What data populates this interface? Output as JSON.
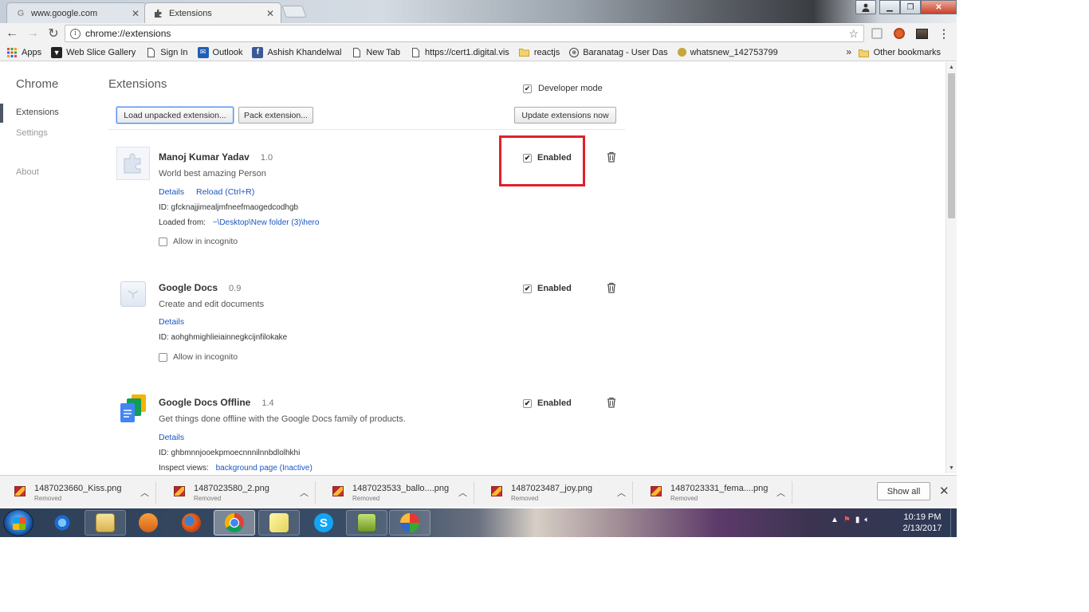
{
  "tabs": [
    {
      "title": "www.google.com",
      "favicon": "google-icon"
    },
    {
      "title": "Extensions",
      "favicon": "puzzle-icon"
    }
  ],
  "toolbar": {
    "url": "chrome://extensions"
  },
  "bookmarks": {
    "items": [
      {
        "label": "Apps",
        "icon": "apps-grid-icon"
      },
      {
        "label": "Web Slice Gallery",
        "icon": "web-slice-icon"
      },
      {
        "label": "Sign In",
        "icon": "page-icon"
      },
      {
        "label": "Outlook",
        "icon": "outlook-icon"
      },
      {
        "label": "Ashish Khandelwal",
        "icon": "facebook-icon"
      },
      {
        "label": "New Tab",
        "icon": "page-icon"
      },
      {
        "label": "https://cert1.digital.vis",
        "icon": "page-icon"
      },
      {
        "label": "reactjs",
        "icon": "folder-icon"
      },
      {
        "label": "Baranatag - User Das",
        "icon": "globe-icon"
      },
      {
        "label": "whatsnew_142753799",
        "icon": "emoji-icon"
      }
    ],
    "more": "»",
    "other": "Other bookmarks"
  },
  "sidebar": {
    "title": "Chrome",
    "items": [
      {
        "label": "Extensions"
      },
      {
        "label": "Settings"
      },
      {
        "label": "About"
      }
    ]
  },
  "main": {
    "title": "Extensions",
    "developer_mode": {
      "label": "Developer mode",
      "checked": true
    },
    "buttons": {
      "load_unpacked": "Load unpacked extension...",
      "pack": "Pack extension...",
      "update": "Update extensions now"
    },
    "extensions": [
      {
        "name": "Manoj Kumar Yadav",
        "version": "1.0",
        "description": "World best amazing Person",
        "links": [
          "Details",
          "Reload (Ctrl+R)"
        ],
        "id_line": "ID: gfcknajjimealjmfneefmaogedcodhgb",
        "loaded_label": "Loaded from:",
        "loaded_path": "~\\Desktop\\New folder (3)\\hero",
        "incognito": "Allow in incognito",
        "enabled": "Enabled"
      },
      {
        "name": "Google Docs",
        "version": "0.9",
        "description": "Create and edit documents",
        "links": [
          "Details"
        ],
        "id_line": "ID: aohghmighlieiainnegkcijnfilokake",
        "incognito": "Allow in incognito",
        "enabled": "Enabled"
      },
      {
        "name": "Google Docs Offline",
        "version": "1.4",
        "description": "Get things done offline with the Google Docs family of products.",
        "links": [
          "Details"
        ],
        "id_line": "ID: ghbmnnjooekpmoecnnnilnnbdlolhkhi",
        "inspect_label": "Inspect views:",
        "inspect_link": "background page (Inactive)",
        "enabled": "Enabled"
      }
    ]
  },
  "downloads": {
    "items": [
      {
        "name": "1487023660_Kiss.png",
        "status": "Removed"
      },
      {
        "name": "1487023580_2.png",
        "status": "Removed"
      },
      {
        "name": "1487023533_ballo....png",
        "status": "Removed"
      },
      {
        "name": "1487023487_joy.png",
        "status": "Removed"
      },
      {
        "name": "1487023331_fema....png",
        "status": "Removed"
      }
    ],
    "show_all": "Show all"
  },
  "taskbar": {
    "apps": [
      "ie-icon",
      "explorer-icon",
      "media-player-icon",
      "firefox-icon",
      "chrome-icon",
      "sticky-notes-icon",
      "skype-icon",
      "notepad-icon",
      "paint-icon"
    ],
    "time": "10:19 PM",
    "date": "2/13/2017"
  },
  "colors": {
    "highlight": "#e0202a",
    "link": "#1a56c4"
  }
}
